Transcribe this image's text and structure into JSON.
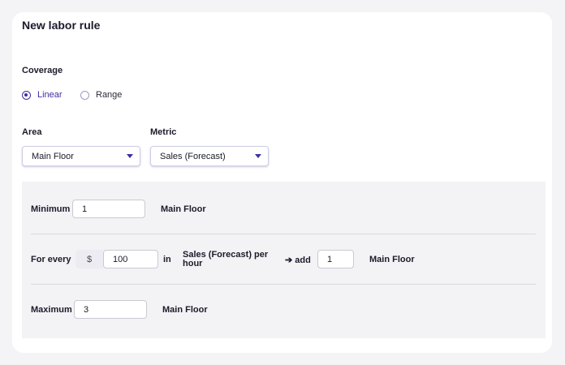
{
  "title": "New labor rule",
  "coverage": {
    "label": "Coverage",
    "options": [
      {
        "label": "Linear",
        "selected": true
      },
      {
        "label": "Range",
        "selected": false
      }
    ]
  },
  "area": {
    "label": "Area",
    "value": "Main Floor"
  },
  "metric": {
    "label": "Metric",
    "value": "Sales (Forecast)"
  },
  "rules": {
    "minimum": {
      "label": "Minimum",
      "value": "1",
      "unit": "Main Floor"
    },
    "for_every": {
      "label": "For every",
      "currency": "$",
      "amount": "100",
      "in_label": "in",
      "metric_line1": "Sales (Forecast) per",
      "metric_line2": "hour",
      "add_label": "➔ add",
      "add_value": "1",
      "unit": "Main Floor"
    },
    "maximum": {
      "label": "Maximum",
      "value": "3",
      "unit": "Main Floor"
    }
  },
  "colors": {
    "accent": "#3e2fa3",
    "panel": "#f3f3f6"
  }
}
